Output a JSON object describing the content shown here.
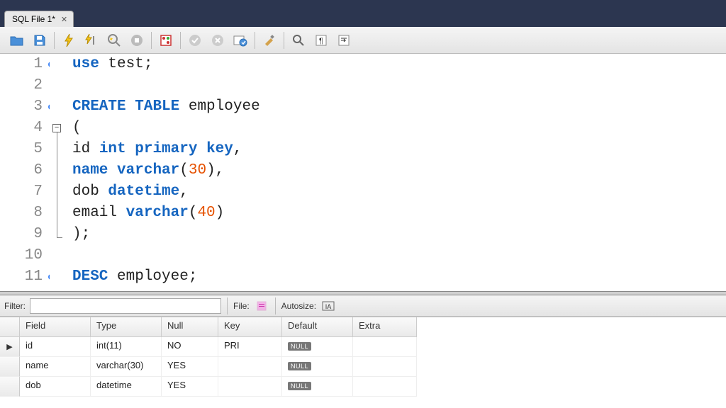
{
  "tab": {
    "title": "SQL File 1*"
  },
  "toolbar": [
    "open",
    "save",
    "execute",
    "execute-step",
    "explain",
    "stop",
    "commit",
    "rollback",
    "cancel",
    "autocommit",
    "format",
    "search",
    "show-whitespace",
    "wrap"
  ],
  "code": {
    "lines": [
      {
        "n": 1,
        "dot": true,
        "tokens": [
          [
            "kw-blue",
            "use"
          ],
          [
            "plain",
            " test;"
          ]
        ]
      },
      {
        "n": 2,
        "dot": false,
        "tokens": []
      },
      {
        "n": 3,
        "dot": true,
        "tokens": [
          [
            "kw-blue",
            "CREATE"
          ],
          [
            "plain",
            " "
          ],
          [
            "kw-blue",
            "TABLE"
          ],
          [
            "plain",
            " employee"
          ]
        ]
      },
      {
        "n": 4,
        "dot": false,
        "tokens": [
          [
            "plain",
            "("
          ]
        ]
      },
      {
        "n": 5,
        "dot": false,
        "tokens": [
          [
            "plain",
            "id "
          ],
          [
            "kw-blue",
            "int"
          ],
          [
            "plain",
            " "
          ],
          [
            "kw-blue",
            "primary"
          ],
          [
            "plain",
            " "
          ],
          [
            "kw-blue",
            "key"
          ],
          [
            "plain",
            ","
          ]
        ]
      },
      {
        "n": 6,
        "dot": false,
        "tokens": [
          [
            "kw-blue",
            "name"
          ],
          [
            "plain",
            " "
          ],
          [
            "kw-blue",
            "varchar"
          ],
          [
            "plain",
            "("
          ],
          [
            "num",
            "30"
          ],
          [
            "plain",
            "),"
          ]
        ]
      },
      {
        "n": 7,
        "dot": false,
        "tokens": [
          [
            "plain",
            "dob "
          ],
          [
            "kw-blue",
            "datetime"
          ],
          [
            "plain",
            ","
          ]
        ]
      },
      {
        "n": 8,
        "dot": false,
        "tokens": [
          [
            "plain",
            "email "
          ],
          [
            "kw-blue",
            "varchar"
          ],
          [
            "plain",
            "("
          ],
          [
            "num",
            "40"
          ],
          [
            "plain",
            ")"
          ]
        ]
      },
      {
        "n": 9,
        "dot": false,
        "tokens": [
          [
            "plain",
            ");"
          ]
        ]
      },
      {
        "n": 10,
        "dot": false,
        "tokens": []
      },
      {
        "n": 11,
        "dot": true,
        "tokens": [
          [
            "kw-blue",
            "DESC"
          ],
          [
            "plain",
            " employee;"
          ]
        ]
      }
    ]
  },
  "results_bar": {
    "filter_label": "Filter:",
    "file_label": "File:",
    "autosize_label": "Autosize:"
  },
  "grid": {
    "columns": [
      "Field",
      "Type",
      "Null",
      "Key",
      "Default",
      "Extra"
    ],
    "rows": [
      {
        "selected": true,
        "field": "id",
        "type": "int(11)",
        "null": "NO",
        "key": "PRI",
        "default": "NULL",
        "extra": ""
      },
      {
        "selected": false,
        "field": "name",
        "type": "varchar(30)",
        "null": "YES",
        "key": "",
        "default": "NULL",
        "extra": ""
      },
      {
        "selected": false,
        "field": "dob",
        "type": "datetime",
        "null": "YES",
        "key": "",
        "default": "NULL",
        "extra": ""
      }
    ]
  }
}
